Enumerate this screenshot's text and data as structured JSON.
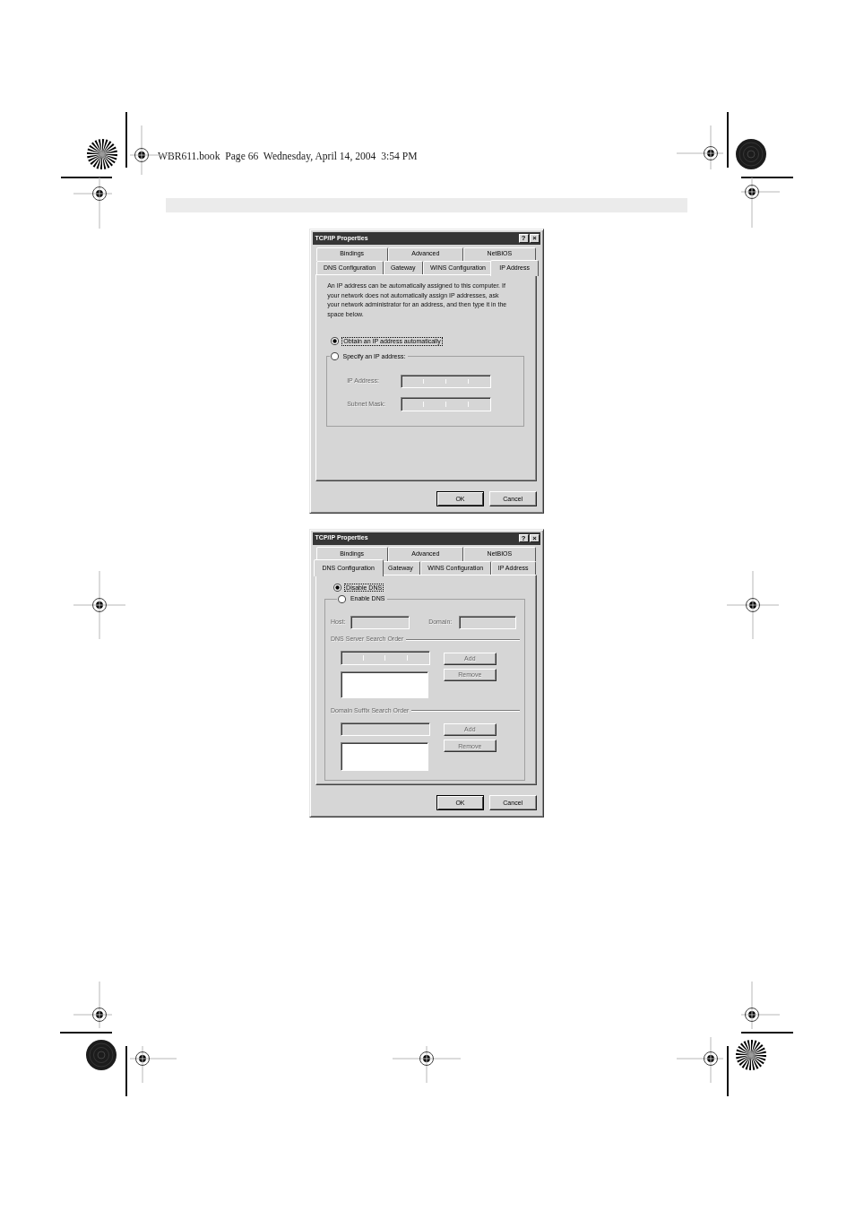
{
  "header": {
    "text": "WBR611.book  Page 66  Wednesday, April 14, 2004  3:54 PM"
  },
  "dialogs": [
    {
      "title": "TCP/IP Properties",
      "help_button": "?",
      "close_button": "×",
      "tab_rows": [
        [
          {
            "label": "Bindings",
            "selected": false
          },
          {
            "label": "Advanced",
            "selected": false
          },
          {
            "label": "NetBIOS",
            "selected": false
          }
        ],
        [
          {
            "label": "DNS Configuration",
            "selected": false
          },
          {
            "label": "Gateway",
            "selected": false
          },
          {
            "label": "WINS Configuration",
            "selected": false
          },
          {
            "label": "IP Address",
            "selected": true
          }
        ]
      ],
      "panel": {
        "kind": "ip_address",
        "description": "An IP address can be automatically assigned to this computer. If your network does not automatically assign IP addresses, ask your network administrator for an address, and then type it in the space below.",
        "options": [
          {
            "label": "Obtain an IP address automatically",
            "selected": true,
            "focused": true
          },
          {
            "label": "Specify an IP address:",
            "selected": false,
            "focused": false
          }
        ],
        "fields": [
          {
            "label": "IP Address:",
            "kind": "ip",
            "disabled": true
          },
          {
            "label": "Subnet Mask:",
            "kind": "ip",
            "disabled": true
          }
        ]
      },
      "buttons": [
        {
          "label": "OK",
          "default": true
        },
        {
          "label": "Cancel",
          "default": false
        }
      ]
    },
    {
      "title": "TCP/IP Properties",
      "help_button": "?",
      "close_button": "×",
      "tab_rows": [
        [
          {
            "label": "Bindings",
            "selected": false
          },
          {
            "label": "Advanced",
            "selected": false
          },
          {
            "label": "NetBIOS",
            "selected": false
          }
        ],
        [
          {
            "label": "DNS Configuration",
            "selected": true
          },
          {
            "label": "Gateway",
            "selected": false
          },
          {
            "label": "WINS Configuration",
            "selected": false
          },
          {
            "label": "IP Address",
            "selected": false
          }
        ]
      ],
      "panel": {
        "kind": "dns",
        "options": [
          {
            "label": "Disable DNS",
            "selected": true,
            "focused": true
          },
          {
            "label": "Enable DNS",
            "selected": false,
            "focused": false
          }
        ],
        "fields": [
          {
            "label": "Host:",
            "kind": "text",
            "disabled": true
          },
          {
            "label": "Domain:",
            "kind": "text",
            "disabled": true
          }
        ],
        "sections": [
          {
            "title": "DNS Server Search Order",
            "entry": {
              "kind": "ip"
            },
            "disabled": true,
            "buttons": [
              "Add",
              "Remove"
            ]
          },
          {
            "title": "Domain Suffix Search Order",
            "entry": {
              "kind": "text"
            },
            "disabled": true,
            "buttons": [
              "Add",
              "Remove"
            ]
          }
        ]
      },
      "buttons": [
        {
          "label": "OK",
          "default": true
        },
        {
          "label": "Cancel",
          "default": false
        }
      ]
    }
  ]
}
